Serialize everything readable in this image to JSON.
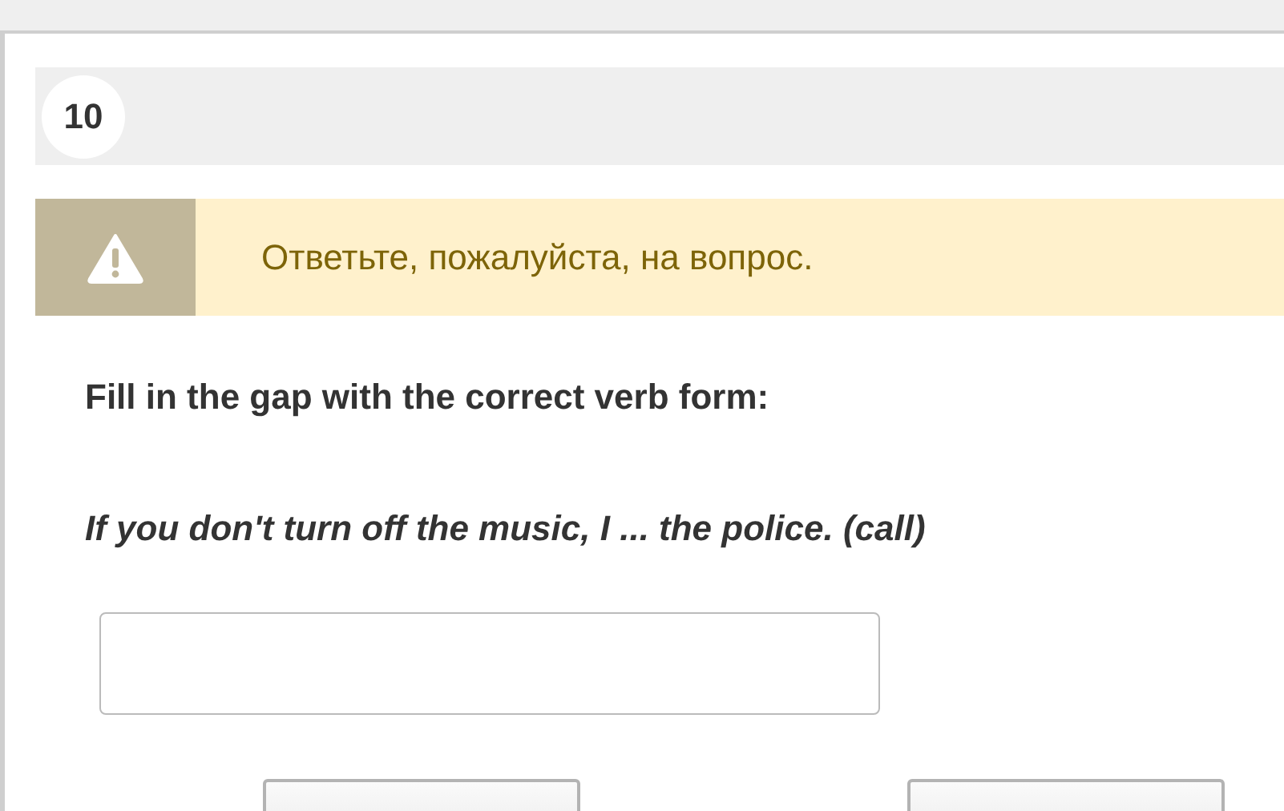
{
  "question": {
    "number": "10"
  },
  "alert": {
    "message": "Ответьте, пожалуйста, на вопрос."
  },
  "instruction": "Fill in the gap with the correct verb form:",
  "sentence": "If you don't turn off the music, I ... the police. (call)",
  "buttons": [
    {
      "kind": "button"
    },
    {
      "kind": "button"
    }
  ]
}
